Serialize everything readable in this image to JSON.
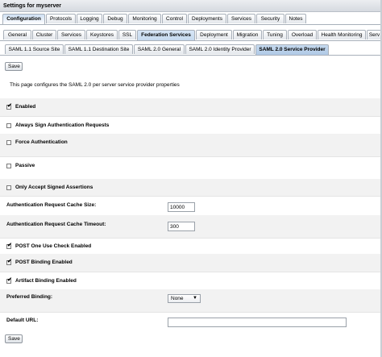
{
  "window": {
    "title": "Settings for myserver"
  },
  "tabs_primary": [
    {
      "label": "Configuration",
      "active": true
    },
    {
      "label": "Protocols",
      "active": false
    },
    {
      "label": "Logging",
      "active": false
    },
    {
      "label": "Debug",
      "active": false
    },
    {
      "label": "Monitoring",
      "active": false
    },
    {
      "label": "Control",
      "active": false
    },
    {
      "label": "Deployments",
      "active": false
    },
    {
      "label": "Services",
      "active": false
    },
    {
      "label": "Security",
      "active": false
    },
    {
      "label": "Notes",
      "active": false
    }
  ],
  "tabs_secondary": [
    {
      "label": "General",
      "active": false
    },
    {
      "label": "Cluster",
      "active": false
    },
    {
      "label": "Services",
      "active": false
    },
    {
      "label": "Keystores",
      "active": false
    },
    {
      "label": "SSL",
      "active": false
    },
    {
      "label": "Federation Services",
      "active": true
    },
    {
      "label": "Deployment",
      "active": false
    },
    {
      "label": "Migration",
      "active": false
    },
    {
      "label": "Tuning",
      "active": false
    },
    {
      "label": "Overload",
      "active": false
    },
    {
      "label": "Health Monitoring",
      "active": false
    },
    {
      "label": "Serv",
      "active": false
    }
  ],
  "tabs_tertiary": [
    {
      "label": "SAML 1.1 Source Site",
      "active": false
    },
    {
      "label": "SAML 1.1 Destination Site",
      "active": false
    },
    {
      "label": "SAML 2.0 General",
      "active": false
    },
    {
      "label": "SAML 2.0 Identity Provider",
      "active": false
    },
    {
      "label": "SAML 2.0 Service Provider",
      "active": true
    }
  ],
  "buttons": {
    "save_top": "Save",
    "save_bottom": "Save"
  },
  "intro": "This page configures the SAML 2.0 per server service provider properties",
  "fields": {
    "enabled": {
      "label": "Enabled",
      "checked": true
    },
    "always_sign": {
      "label": "Always Sign Authentication Requests",
      "checked": false
    },
    "force_auth": {
      "label": "Force Authentication",
      "checked": false
    },
    "passive": {
      "label": "Passive",
      "checked": false
    },
    "only_signed": {
      "label": "Only Accept Signed Assertions",
      "checked": false
    },
    "cache_size": {
      "label": "Authentication Request Cache Size:",
      "value": "10000"
    },
    "cache_timeout": {
      "label": "Authentication Request Cache Timeout:",
      "value": "300"
    },
    "post_one_use": {
      "label": "POST One Use Check Enabled",
      "checked": true
    },
    "post_binding": {
      "label": "POST Binding Enabled",
      "checked": true
    },
    "artifact_binding": {
      "label": "Artifact Binding Enabled",
      "checked": true
    },
    "preferred_binding": {
      "label": "Preferred Binding:",
      "value": "None"
    },
    "default_url": {
      "label": "Default URL:",
      "value": ""
    }
  },
  "check_glyph": "✔",
  "select_arrow_glyph": "▼",
  "colors": {
    "active_tab": "#c5d9ee",
    "band": "#f2f2f2",
    "border": "#a8b0ba"
  }
}
